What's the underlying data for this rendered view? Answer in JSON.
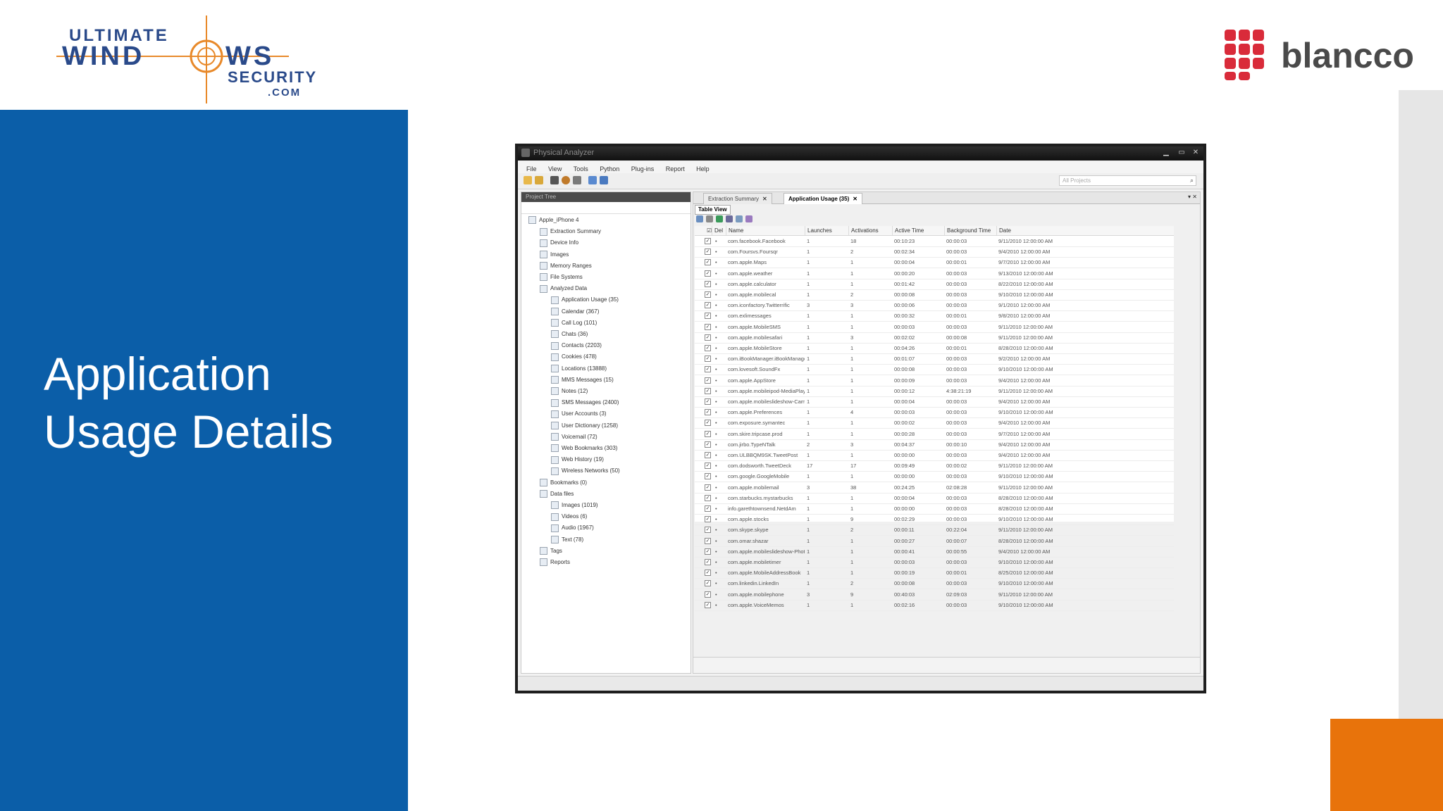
{
  "slide": {
    "title_line1": "Application",
    "title_line2": "Usage Details",
    "colors": {
      "panel_blue": "#0b5ea8",
      "accent_orange": "#e8730b",
      "blancco_red": "#d92b3a"
    }
  },
  "logos": {
    "uws": {
      "line1": "ULTIMATE",
      "line2a": "WIND",
      "line2b": "WS",
      "line3": "SECURITY",
      "line4": ".COM"
    },
    "blancco": {
      "text": "blancco"
    }
  },
  "app": {
    "title": "Physical Analyzer",
    "menu": [
      "File",
      "View",
      "Tools",
      "Python",
      "Plug-ins",
      "Report",
      "Help"
    ],
    "search_placeholder": "All Projects",
    "tree_header": "Project Tree",
    "tree": [
      "Apple_iPhone 4",
      "Extraction Summary",
      "Device Info",
      "Images",
      "Memory Ranges",
      "File Systems",
      "Analyzed Data",
      "Application Usage (35)",
      "Calendar (367)",
      "Call Log (101)",
      "Chats (36)",
      "Contacts (2203)",
      "Cookies (478)",
      "Locations (13888)",
      "MMS Messages (15)",
      "Notes (12)",
      "SMS Messages (2400)",
      "User Accounts (3)",
      "User Dictionary (1258)",
      "Voicemail (72)",
      "Web Bookmarks (303)",
      "Web History (19)",
      "Wireless Networks (50)",
      "Bookmarks (0)",
      "Data files",
      "Images (1019)",
      "Videos (6)",
      "Audio (1967)",
      "Text (78)",
      "Tags",
      "Reports"
    ],
    "tabs": [
      "Extraction Summary",
      "Application Usage (35)"
    ],
    "subtab": "Table View",
    "columns": [
      "Del",
      "Name",
      "Launches",
      "Activations",
      "Active Time",
      "Background Time",
      "Date"
    ],
    "rows": [
      [
        "com.facebook.Facebook",
        "1",
        "18",
        "00:10:23",
        "00:00:03",
        "9/11/2010 12:00:00 AM"
      ],
      [
        "com.Foursvs.Foursqr",
        "1",
        "2",
        "00:02:34",
        "00:00:03",
        "9/4/2010 12:00:00 AM"
      ],
      [
        "com.apple.Maps",
        "1",
        "1",
        "00:00:04",
        "00:00:01",
        "9/7/2010 12:00:00 AM"
      ],
      [
        "com.apple.weather",
        "1",
        "1",
        "00:00:20",
        "00:00:03",
        "9/13/2010 12:00:00 AM"
      ],
      [
        "com.apple.calculator",
        "1",
        "1",
        "00:01:42",
        "00:00:03",
        "8/22/2010 12:00:00 AM"
      ],
      [
        "com.apple.mobilecal",
        "1",
        "2",
        "00:00:08",
        "00:00:03",
        "9/10/2010 12:00:00 AM"
      ],
      [
        "com.iconfactory.Twitterrific",
        "3",
        "3",
        "00:00:06",
        "00:00:03",
        "9/1/2010 12:00:00 AM"
      ],
      [
        "com.exlimessages",
        "1",
        "1",
        "00:00:32",
        "00:00:01",
        "9/8/2010 12:00:00 AM"
      ],
      [
        "com.apple.MobileSMS",
        "1",
        "1",
        "00:00:03",
        "00:00:03",
        "9/11/2010 12:00:00 AM"
      ],
      [
        "com.apple.mobilesafari",
        "1",
        "3",
        "00:02:02",
        "00:00:08",
        "9/11/2010 12:00:00 AM"
      ],
      [
        "com.apple.MobileStore",
        "1",
        "1",
        "00:04:26",
        "00:00:01",
        "8/28/2010 12:00:00 AM"
      ],
      [
        "com.iBookManager.iBookManager",
        "1",
        "1",
        "00:01:07",
        "00:00:03",
        "9/2/2010 12:00:00 AM"
      ],
      [
        "com.lovesoft.SoundFx",
        "1",
        "1",
        "00:00:08",
        "00:00:03",
        "9/10/2010 12:00:00 AM"
      ],
      [
        "com.apple.AppStore",
        "1",
        "1",
        "00:00:09",
        "00:00:03",
        "9/4/2010 12:00:00 AM"
      ],
      [
        "com.apple.mobileipod-MediaPlayer",
        "1",
        "1",
        "00:00:12",
        "4:38:21:19",
        "9/11/2010 12:00:00 AM"
      ],
      [
        "com.apple.mobileslideshow-Camera",
        "1",
        "1",
        "00:00:04",
        "00:00:03",
        "9/4/2010 12:00:00 AM"
      ],
      [
        "com.apple.Preferences",
        "1",
        "4",
        "00:00:03",
        "00:00:03",
        "9/10/2010 12:00:00 AM"
      ],
      [
        "com.exposure.symantec",
        "1",
        "1",
        "00:00:02",
        "00:00:03",
        "9/4/2010 12:00:00 AM"
      ],
      [
        "com.skire.tripcase.prod",
        "1",
        "1",
        "00:00:28",
        "00:00:03",
        "9/7/2010 12:00:00 AM"
      ],
      [
        "com.jirbo.TypeNTalk",
        "2",
        "3",
        "00:04:37",
        "00:00:10",
        "9/4/2010 12:00:00 AM"
      ],
      [
        "com.ULBBQM9SK.TweetPost",
        "1",
        "1",
        "00:00:00",
        "00:00:03",
        "9/4/2010 12:00:00 AM"
      ],
      [
        "com.dodsworth.TweetDeck",
        "17",
        "17",
        "00:09:49",
        "00:00:02",
        "9/11/2010 12:00:00 AM"
      ],
      [
        "com.google.GoogleMobile",
        "1",
        "1",
        "00:00:00",
        "00:00:03",
        "9/10/2010 12:00:00 AM"
      ],
      [
        "com.apple.mobilemail",
        "3",
        "38",
        "00:24:25",
        "02:08:28",
        "9/11/2010 12:00:00 AM"
      ],
      [
        "com.starbucks.mystarbucks",
        "1",
        "1",
        "00:00:04",
        "00:00:03",
        "8/28/2010 12:00:00 AM"
      ],
      [
        "info.garethtownsend.NetdAm",
        "1",
        "1",
        "00:00:00",
        "00:00:03",
        "8/28/2010 12:00:00 AM"
      ],
      [
        "com.apple.stocks",
        "1",
        "9",
        "00:02:29",
        "00:00:03",
        "9/10/2010 12:00:00 AM"
      ],
      [
        "com.skype.skype",
        "1",
        "2",
        "00:00:11",
        "00:22:04",
        "9/11/2010 12:00:00 AM"
      ],
      [
        "com.omar.shazar",
        "1",
        "1",
        "00:00:27",
        "00:00:07",
        "8/28/2010 12:00:00 AM"
      ],
      [
        "com.apple.mobileslideshow-Photos",
        "1",
        "1",
        "00:00:41",
        "00:00:55",
        "9/4/2010 12:00:00 AM"
      ],
      [
        "com.apple.mobiletimer",
        "1",
        "1",
        "00:00:03",
        "00:00:03",
        "9/10/2010 12:00:00 AM"
      ],
      [
        "com.apple.MobileAddressBook",
        "1",
        "1",
        "00:00:19",
        "00:00:01",
        "8/25/2010 12:00:00 AM"
      ],
      [
        "com.linkedin.LinkedIn",
        "1",
        "2",
        "00:00:08",
        "00:00:03",
        "9/10/2010 12:00:00 AM"
      ],
      [
        "com.apple.mobilephone",
        "3",
        "9",
        "00:40:03",
        "02:09:03",
        "9/11/2010 12:00:00 AM"
      ],
      [
        "com.apple.VoiceMemos",
        "1",
        "1",
        "00:02:16",
        "00:00:03",
        "9/10/2010 12:00:00 AM"
      ]
    ]
  }
}
